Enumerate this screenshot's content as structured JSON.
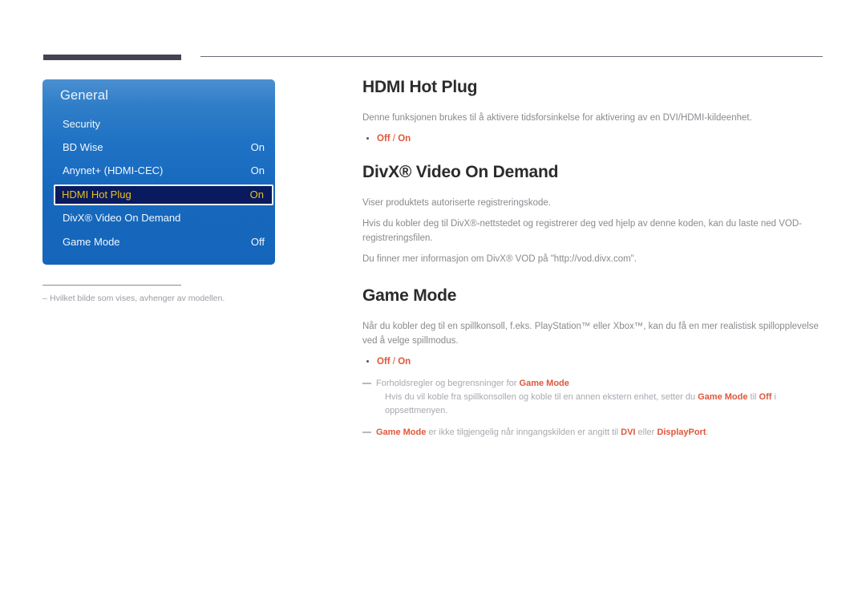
{
  "header": {
    "left_bar": "",
    "right_rule": ""
  },
  "osd": {
    "title": "General",
    "rows": [
      {
        "label": "Security",
        "value": "",
        "selected": false
      },
      {
        "label": "BD Wise",
        "value": "On",
        "selected": false
      },
      {
        "label": "Anynet+ (HDMI-CEC)",
        "value": "On",
        "selected": false
      },
      {
        "label": "HDMI Hot Plug",
        "value": "On",
        "selected": true
      },
      {
        "label": "DivX® Video On Demand",
        "value": "",
        "selected": false
      },
      {
        "label": "Game Mode",
        "value": "Off",
        "selected": false
      }
    ],
    "colors": {
      "panel_top": "#4b8fd1",
      "panel_bottom": "#1566bb",
      "selected_bg": "#0a1a5e",
      "selected_text": "#e9c11c",
      "selected_border": "#f2f4f8"
    }
  },
  "footnote": {
    "dash": "–",
    "text": "Hvilket bilde som vises, avhenger av modellen."
  },
  "sections": {
    "hdmi_hot_plug": {
      "title": "HDMI Hot Plug",
      "body": "Denne funksjonen brukes til å aktivere tidsforsinkelse for aktivering av en DVI/HDMI-kildeenhet.",
      "options": {
        "off": "Off",
        "separator": " / ",
        "on": "On"
      }
    },
    "divx": {
      "title": "DivX® Video On Demand",
      "body_lines": [
        "Viser produktets autoriserte registreringskode.",
        "Hvis du kobler deg til DivX®-nettstedet og registrerer deg ved hjelp av denne koden, kan du laste ned VOD-registreringsfilen.",
        "Du finner mer informasjon om DivX® VOD på \"http://vod.divx.com\"."
      ]
    },
    "game_mode": {
      "title": "Game Mode",
      "body": "Når du kobler deg til en spillkonsoll, f.eks. PlayStation™ eller Xbox™, kan du få en mer realistisk spillopplevelse ved å velge spillmodus.",
      "options": {
        "off": "Off",
        "separator": " / ",
        "on": "On"
      },
      "note1_prefix": "Forholdsregler og begrensninger for ",
      "note1_accent": "Game Mode",
      "note1_sub_a": "Hvis du  vil koble fra spillkonsollen og koble til en annen ekstern enhet, setter du ",
      "note1_sub_accent1": "Game Mode",
      "note1_sub_b": " til ",
      "note1_sub_accent2": "Off",
      "note1_sub_c": " i oppsettmenyen.",
      "note2_accent1": "Game Mode",
      "note2_a": " er ikke tilgjengelig når inngangskilden er angitt til ",
      "note2_accent2": "DVI",
      "note2_b": " eller ",
      "note2_accent3": "DisplayPort",
      "note2_c": "."
    }
  },
  "colors": {
    "accent": "#e0563a",
    "body_text": "#8a8a90",
    "heading": "#2b2b2b",
    "rule_dark": "#454254"
  }
}
